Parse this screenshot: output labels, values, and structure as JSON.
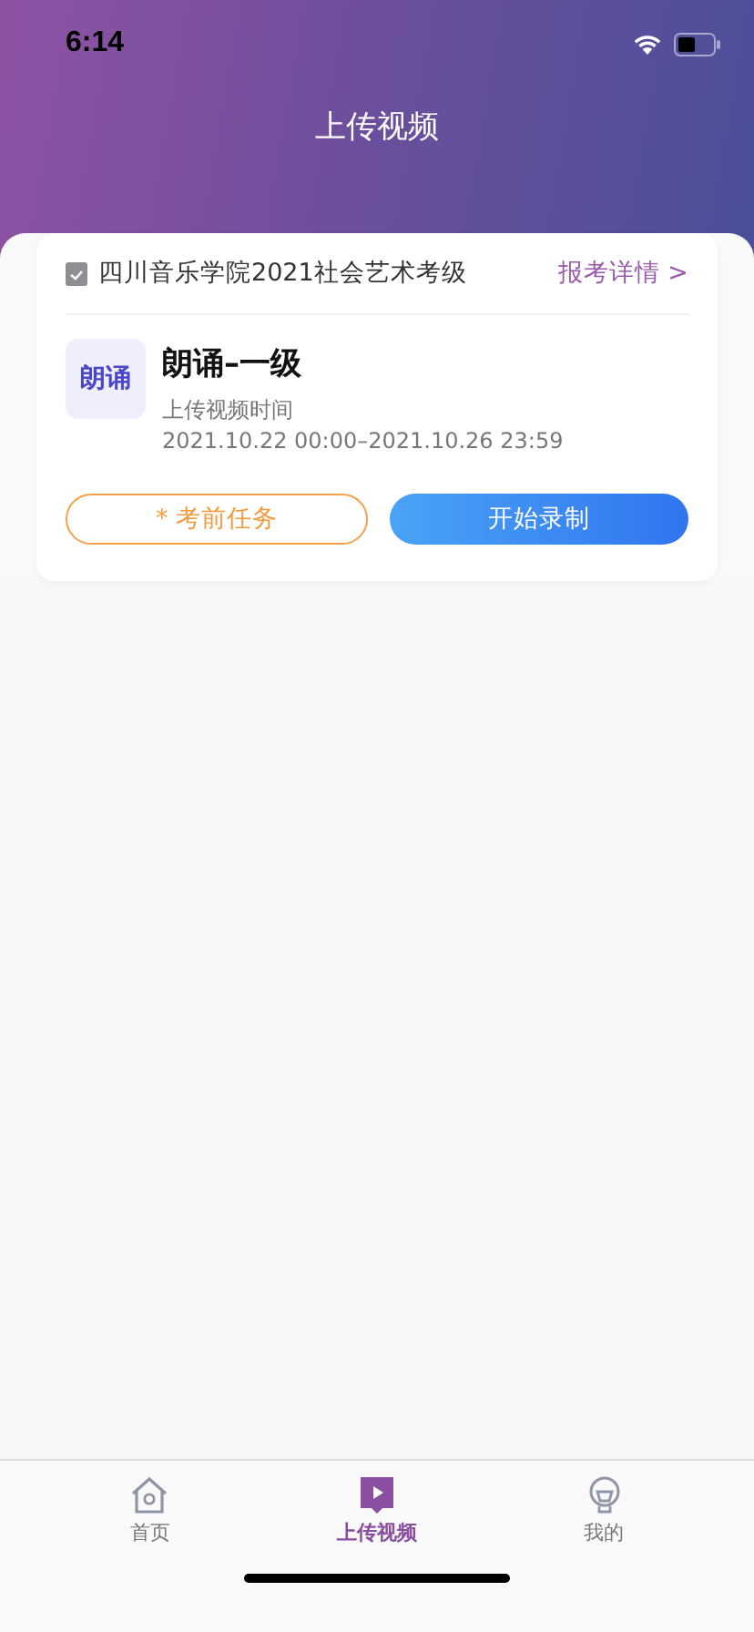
{
  "status_bar": {
    "time": "6:14"
  },
  "header": {
    "title": "上传视频"
  },
  "exam": {
    "name": "四川音乐学院2021社会艺术考级",
    "details_link": "报考详情 >"
  },
  "course": {
    "thumb_text": "朗诵",
    "title": "朗诵–一级",
    "time_label": "上传视频时间",
    "time_range": "2021.10.22 00:00–2021.10.26 23:59"
  },
  "buttons": [
    {
      "kind": "outline",
      "label": "* 考前任务"
    },
    {
      "kind": "primary",
      "label": "开始录制"
    }
  ],
  "tab_bar": [
    {
      "kind": "home",
      "label": "首页",
      "selected": false
    },
    {
      "kind": "video",
      "label": "上传视频",
      "selected": true
    },
    {
      "kind": "profile",
      "label": "我的",
      "selected": false
    }
  ]
}
